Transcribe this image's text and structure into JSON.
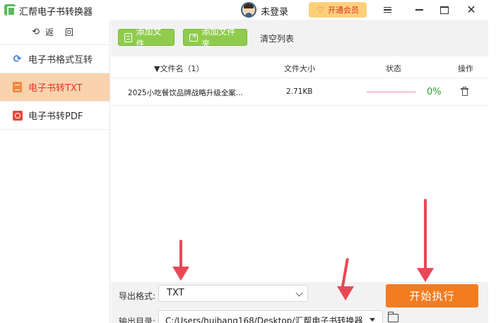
{
  "app": {
    "title": "汇帮电子书转换器",
    "login_text": "未登录",
    "vip_label": "开通会员",
    "close_glyph": "✕"
  },
  "sidebar": {
    "back_label": "返 回",
    "back_glyph": "⟲",
    "items": [
      {
        "label": "电子书格式互转",
        "icon": "sync-icon",
        "active": false,
        "glyph": "⟳"
      },
      {
        "label": "电子书转TXT",
        "icon": "txt-file-icon",
        "active": true
      },
      {
        "label": "电子书转PDF",
        "icon": "pdf-file-icon",
        "active": false
      }
    ]
  },
  "toolbar": {
    "add_file_label": "添加文件",
    "add_folder_label": "添加文件夹",
    "clear_label": "清空列表"
  },
  "table": {
    "headers": {
      "name": "▼文件名（1）",
      "size": "文件大小",
      "status": "状态",
      "action": "操作"
    },
    "rows": [
      {
        "name": "2025小吃餐饮品牌战略升级全案...",
        "size": "2.71KB",
        "progress": 0,
        "progress_text": "0%"
      }
    ]
  },
  "settings": {
    "format_label": "导出格式:",
    "format_value": "TXT",
    "output_label": "输出目录:",
    "output_value": "C:/Users/huibang168/Desktop/汇帮电子书转换器"
  },
  "start_button_label": "开始执行",
  "colors": {
    "accent_orange": "#f47c20",
    "button_green": "#8fcc4e",
    "active_bg": "#f9d3ae",
    "active_text": "#e8342a",
    "annotation_red": "#e84856"
  }
}
